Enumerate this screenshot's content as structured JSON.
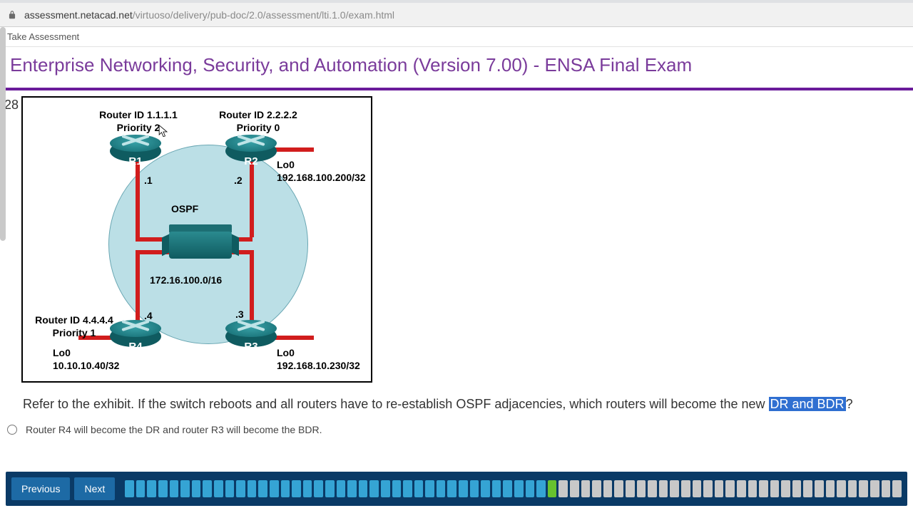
{
  "browser": {
    "url_host": "assessment.netacad.net",
    "url_path": "/virtuoso/delivery/pub-doc/2.0/assessment/lti.1.0/exam.html"
  },
  "header": {
    "take": "Take Assessment",
    "title": "Enterprise Networking, Security, and Automation (Version 7.00) - ENSA Final Exam"
  },
  "question": {
    "number": "28",
    "text_pre": "Refer to the exhibit. If the switch reboots and all routers have to re-establish OSPF adjacencies, which routers will become the new ",
    "highlight": "DR and BDR",
    "text_post": "?",
    "option1": "Router R4 will become the DR and router R3 will become the BDR."
  },
  "diagram": {
    "r1": {
      "name": "R1",
      "id": "Router ID 1.1.1.1",
      "prio": "Priority 2",
      "host": ".1"
    },
    "r2": {
      "name": "R2",
      "id": "Router ID 2.2.2.2",
      "prio": "Priority 0",
      "host": ".2",
      "lo_lbl": "Lo0",
      "lo_net": "192.168.100.200/32"
    },
    "r3": {
      "name": "R3",
      "host": ".3",
      "lo_lbl": "Lo0",
      "lo_net": "192.168.10.230/32"
    },
    "r4": {
      "name": "R4",
      "id": "Router ID 4.4.4.4",
      "prio": "Priority 1",
      "host": ".4",
      "lo_lbl": "Lo0",
      "lo_net": "10.10.10.40/32"
    },
    "area": "OSPF",
    "subnet": "172.16.100.0/16"
  },
  "nav": {
    "prev": "Previous",
    "next": "Next",
    "progress": {
      "done": 38,
      "current": 1,
      "todo": 31
    }
  }
}
